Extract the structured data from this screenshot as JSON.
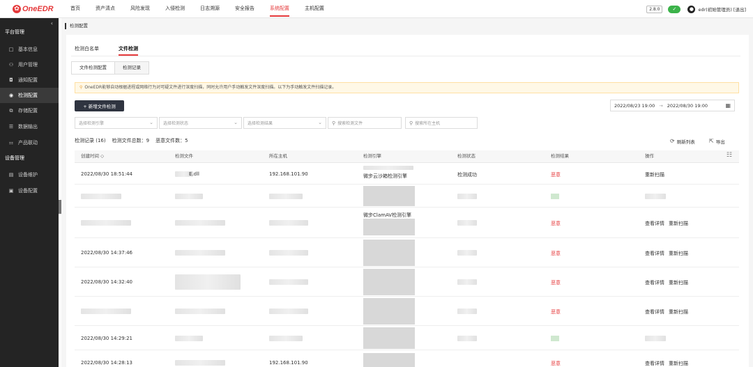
{
  "app": {
    "logo_text": "OneEDR",
    "version": "2.8.0",
    "user": "edr(初始管理员) [退出]"
  },
  "topnav": [
    "首页",
    "资产清点",
    "风险发现",
    "入侵检测",
    "日志溯源",
    "安全报告",
    "系统配置",
    "主机配置"
  ],
  "sidebar": {
    "group1": "平台管理",
    "group2": "设备管理",
    "items1": [
      {
        "label": "基本信息",
        "icon": "□"
      },
      {
        "label": "用户管理",
        "icon": "⚇"
      },
      {
        "label": "通知配置",
        "icon": "◘"
      },
      {
        "label": "检测配置",
        "icon": "◉"
      },
      {
        "label": "存储配置",
        "icon": "⧉"
      },
      {
        "label": "数据输出",
        "icon": "☰"
      },
      {
        "label": "产品联动",
        "icon": "⚏"
      }
    ],
    "items2": [
      {
        "label": "设备维护",
        "icon": "▤"
      },
      {
        "label": "设备配置",
        "icon": "▣"
      }
    ]
  },
  "breadcrumb": "检测配置",
  "tabs1": [
    "检测白名单",
    "文件检测"
  ],
  "tabs2": [
    "文件检测配置",
    "检测记录"
  ],
  "notice": "OneEDR能够自动根据进程或网络行为对可疑文件进行深度扫描，同时允许用户手动触发文件深度扫描。以下为手动触发文件扫描记录。",
  "new_button": "+ 新增文件检测",
  "date_range": {
    "start": "2022/08/23 19:00",
    "arrow": "→",
    "end": "2022/08/30 19:00"
  },
  "filters": {
    "engine": "选择检测引擎",
    "status": "选择检测状态",
    "result": "选择检测结果",
    "file": "搜索检测文件",
    "host": "搜索所在主机"
  },
  "summary": {
    "records": "检测记录 (16)",
    "files": "检测文件总数：9",
    "malicious": "恶意文件数：5"
  },
  "tools": {
    "refresh": "刷新列表",
    "export": "导出"
  },
  "table": {
    "headers": [
      "创建时间 ◇",
      "检测文件",
      "所在主机",
      "检测引擎",
      "检测状态",
      "检测结果",
      "操作"
    ],
    "rows": [
      {
        "time": "2022/08/30 18:51:44",
        "file": "E.dll",
        "host": "192.168.101.90",
        "engine": "微步云沙箱检测引擎",
        "status": "检测成功",
        "result": "恶意",
        "actions": [
          "重新扫描"
        ]
      },
      {
        "time": "",
        "file": "",
        "host": "",
        "engine": "",
        "status": "",
        "result": "",
        "actions": []
      },
      {
        "time": "",
        "file": "",
        "host": "",
        "engine": "微步ClamAV检测引擎",
        "status": "",
        "result": "恶意",
        "actions": [
          "查看详情",
          "重新扫描"
        ]
      },
      {
        "time": "2022/08/30 14:37:46",
        "file": "",
        "host": "",
        "engine": "",
        "status": "",
        "result": "恶意",
        "actions": [
          "查看详情",
          "重新扫描"
        ]
      },
      {
        "time": "2022/08/30 14:32:40",
        "file": "",
        "host": "",
        "engine": "",
        "status": "",
        "result": "恶意",
        "actions": [
          "查看详情",
          "重新扫描"
        ]
      },
      {
        "time": "",
        "file": "",
        "host": "",
        "engine": "",
        "status": "",
        "result": "恶意",
        "actions": [
          "查看详情",
          "重新扫描"
        ]
      },
      {
        "time": "2022/08/30 14:29:21",
        "file": "",
        "host": "",
        "engine": "",
        "status": "",
        "result": "",
        "actions": []
      },
      {
        "time": "2022/08/30 14:28:13",
        "file": "",
        "host": "192.168.101.90",
        "engine": "",
        "status": "",
        "result": "恶意",
        "actions": [
          "查看详情",
          "重新扫描"
        ]
      }
    ]
  },
  "colors": {
    "accent": "#e5393b",
    "sidebar_bg": "#242424",
    "button_dark": "#2f3440"
  }
}
